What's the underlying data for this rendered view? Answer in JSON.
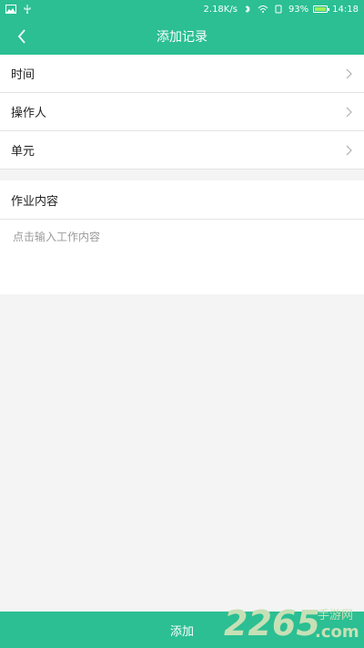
{
  "status_bar": {
    "network_speed": "2.18K/s",
    "battery_percent": "93%",
    "battery_level": 0.93,
    "time": "14:18"
  },
  "nav": {
    "title": "添加记录"
  },
  "form": {
    "rows": [
      {
        "label": "时间"
      },
      {
        "label": "操作人"
      },
      {
        "label": "单元"
      }
    ]
  },
  "content": {
    "header": "作业内容",
    "placeholder": "点击输入工作内容",
    "value": ""
  },
  "footer": {
    "add_label": "添加"
  },
  "watermark": {
    "number": "2265",
    "suffix": "手游网",
    "domain": ".com"
  },
  "colors": {
    "primary": "#2bbf93",
    "watermark": "#c7e0b6"
  }
}
